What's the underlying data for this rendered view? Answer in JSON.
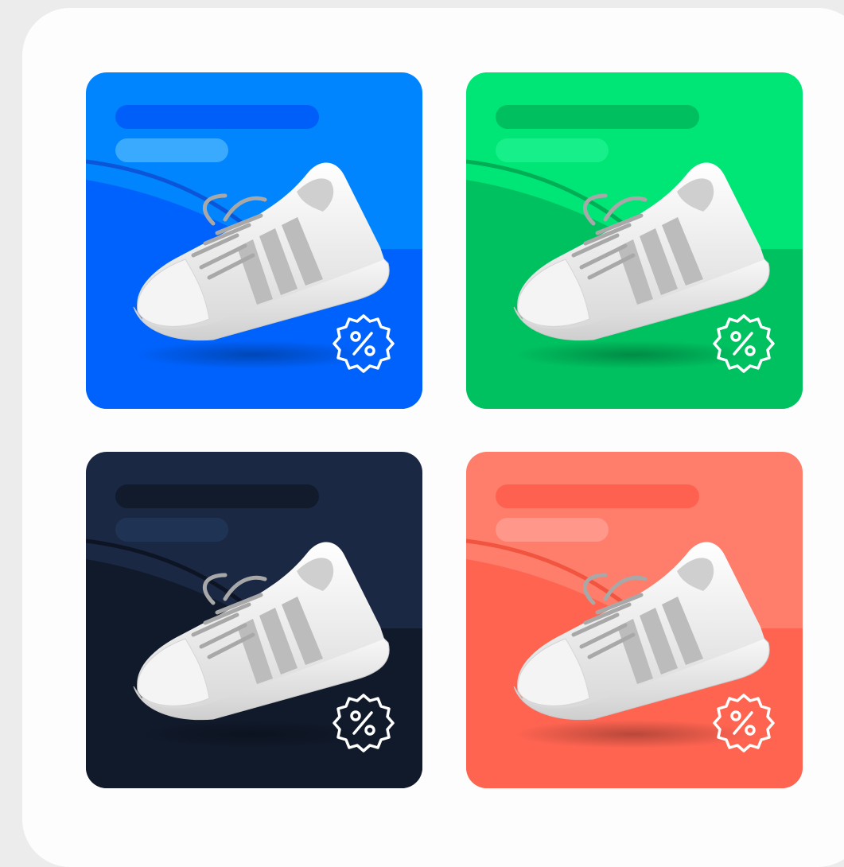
{
  "cards": [
    {
      "id": "blue",
      "colors": {
        "top": "#0085fe",
        "bottom": "#0062fd",
        "title_bar": "#005ff8",
        "sub_bar": "#39aafd",
        "wave": "#0b55d8"
      },
      "badge_icon": "discount-badge-icon",
      "product_icon": "sneaker-icon"
    },
    {
      "id": "green",
      "colors": {
        "top": "#00e676",
        "bottom": "#00c160",
        "title_bar": "#00bf5f",
        "sub_bar": "#17f08a",
        "wave": "#00ae56"
      },
      "badge_icon": "discount-badge-icon",
      "product_icon": "sneaker-icon"
    },
    {
      "id": "navy",
      "colors": {
        "top": "#1a2844",
        "bottom": "#111a2b",
        "title_bar": "#121b2c",
        "sub_bar": "#1f3455",
        "wave": "#0d1424"
      },
      "badge_icon": "discount-badge-icon",
      "product_icon": "sneaker-icon"
    },
    {
      "id": "coral",
      "colors": {
        "top": "#ff7d6b",
        "bottom": "#ff6451",
        "title_bar": "#ff6150",
        "sub_bar": "#ff978a",
        "wave": "#f1553f"
      },
      "badge_icon": "discount-badge-icon",
      "product_icon": "sneaker-icon"
    }
  ]
}
